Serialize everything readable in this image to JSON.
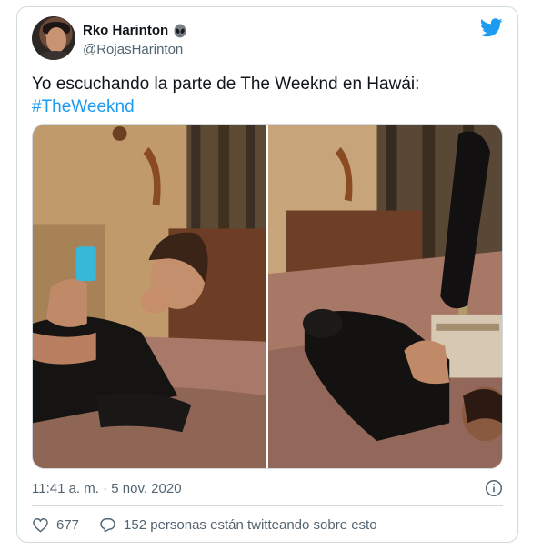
{
  "author": {
    "display_name": "Rko Harinton",
    "handle": "@RojasHarinton",
    "emoji_icon": "alien-icon"
  },
  "tweet": {
    "text": "Yo escuchando la parte de The Weeknd en Hawái:",
    "hashtag": "#TheWeeknd",
    "timestamp": "11:41 a. m. · 5 nov. 2020"
  },
  "engagement": {
    "likes": "677",
    "conversation": "152 personas están twitteando sobre esto"
  },
  "colors": {
    "accent": "#1d9bf0",
    "text": "#0f1419",
    "secondary": "#536471",
    "border": "#cfd9de"
  }
}
